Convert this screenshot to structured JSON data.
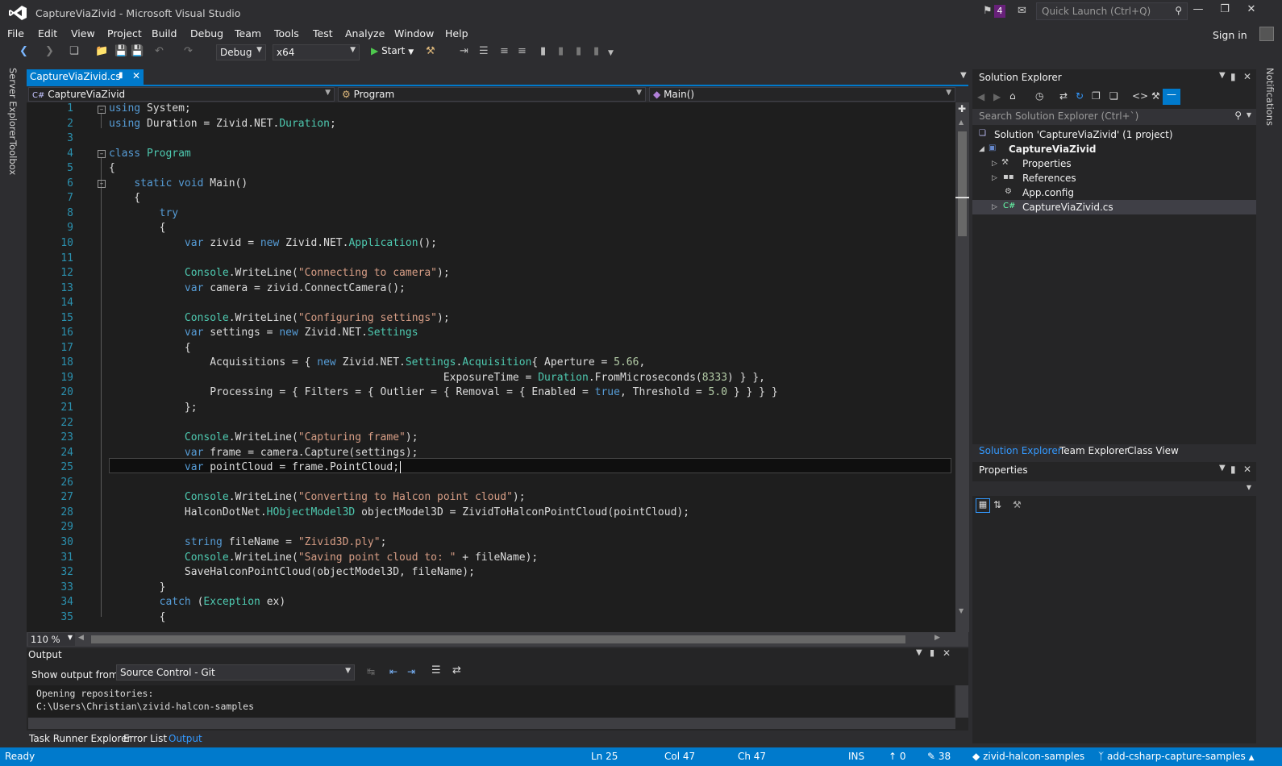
{
  "window": {
    "title": "CaptureViaZivid - Microsoft Visual Studio",
    "notifications_count": "4",
    "quick_launch_placeholder": "Quick Launch (Ctrl+Q)",
    "sign_in": "Sign in"
  },
  "menu": [
    "File",
    "Edit",
    "View",
    "Project",
    "Build",
    "Debug",
    "Team",
    "Tools",
    "Test",
    "Analyze",
    "Window",
    "Help"
  ],
  "toolbar": {
    "configuration": "Debug",
    "platform": "x64",
    "start": "Start"
  },
  "side_tabs": {
    "left": [
      "Server Explorer",
      "Toolbox"
    ],
    "right": [
      "Notifications"
    ]
  },
  "document_tab": {
    "name": "CaptureViaZivid.cs"
  },
  "nav": {
    "project": "CaptureViaZivid",
    "class": "Program",
    "member": "Main()"
  },
  "editor": {
    "line_numbers": [
      "1",
      "2",
      "3",
      "4",
      "5",
      "6",
      "7",
      "8",
      "9",
      "10",
      "11",
      "12",
      "13",
      "14",
      "15",
      "16",
      "17",
      "18",
      "19",
      "20",
      "21",
      "22",
      "23",
      "24",
      "25",
      "26",
      "27",
      "28",
      "29",
      "30",
      "31",
      "32",
      "33",
      "34",
      "35"
    ],
    "lines": [
      [
        {
          "t": "using",
          "c": "kw"
        },
        {
          "t": " System;"
        }
      ],
      [
        {
          "t": "using",
          "c": "kw"
        },
        {
          "t": " Duration = Zivid.NET."
        },
        {
          "t": "Duration",
          "c": "ty"
        },
        {
          "t": ";"
        }
      ],
      [],
      [
        {
          "t": "class",
          "c": "kw"
        },
        {
          "t": " "
        },
        {
          "t": "Program",
          "c": "ty"
        }
      ],
      [
        {
          "t": "{"
        }
      ],
      [
        {
          "t": "    "
        },
        {
          "t": "static",
          "c": "kw"
        },
        {
          "t": " "
        },
        {
          "t": "void",
          "c": "kw"
        },
        {
          "t": " Main()"
        }
      ],
      [
        {
          "t": "    {"
        }
      ],
      [
        {
          "t": "        "
        },
        {
          "t": "try",
          "c": "kw"
        }
      ],
      [
        {
          "t": "        {"
        }
      ],
      [
        {
          "t": "            "
        },
        {
          "t": "var",
          "c": "kw"
        },
        {
          "t": " zivid = "
        },
        {
          "t": "new",
          "c": "kw"
        },
        {
          "t": " Zivid.NET."
        },
        {
          "t": "Application",
          "c": "ty"
        },
        {
          "t": "();"
        }
      ],
      [],
      [
        {
          "t": "            "
        },
        {
          "t": "Console",
          "c": "ty"
        },
        {
          "t": ".WriteLine("
        },
        {
          "t": "\"Connecting to camera\"",
          "c": "st"
        },
        {
          "t": ");"
        }
      ],
      [
        {
          "t": "            "
        },
        {
          "t": "var",
          "c": "kw"
        },
        {
          "t": " camera = zivid.ConnectCamera();"
        }
      ],
      [],
      [
        {
          "t": "            "
        },
        {
          "t": "Console",
          "c": "ty"
        },
        {
          "t": ".WriteLine("
        },
        {
          "t": "\"Configuring settings\"",
          "c": "st"
        },
        {
          "t": ");"
        }
      ],
      [
        {
          "t": "            "
        },
        {
          "t": "var",
          "c": "kw"
        },
        {
          "t": " settings = "
        },
        {
          "t": "new",
          "c": "kw"
        },
        {
          "t": " Zivid.NET."
        },
        {
          "t": "Settings",
          "c": "ty"
        }
      ],
      [
        {
          "t": "            {"
        }
      ],
      [
        {
          "t": "                Acquisitions = { "
        },
        {
          "t": "new",
          "c": "kw"
        },
        {
          "t": " Zivid.NET."
        },
        {
          "t": "Settings",
          "c": "ty"
        },
        {
          "t": "."
        },
        {
          "t": "Acquisition",
          "c": "ty"
        },
        {
          "t": "{ Aperture = "
        },
        {
          "t": "5.66",
          "c": "nm"
        },
        {
          "t": ","
        }
      ],
      [
        {
          "t": "                                                     ExposureTime = "
        },
        {
          "t": "Duration",
          "c": "ty"
        },
        {
          "t": ".FromMicroseconds("
        },
        {
          "t": "8333",
          "c": "nm"
        },
        {
          "t": ") } },"
        }
      ],
      [
        {
          "t": "                Processing = { Filters = { Outlier = { Removal = { Enabled = "
        },
        {
          "t": "true",
          "c": "kw"
        },
        {
          "t": ", Threshold = "
        },
        {
          "t": "5.0",
          "c": "nm"
        },
        {
          "t": " } } } }"
        }
      ],
      [
        {
          "t": "            };"
        }
      ],
      [],
      [
        {
          "t": "            "
        },
        {
          "t": "Console",
          "c": "ty"
        },
        {
          "t": ".WriteLine("
        },
        {
          "t": "\"Capturing frame\"",
          "c": "st"
        },
        {
          "t": ");"
        }
      ],
      [
        {
          "t": "            "
        },
        {
          "t": "var",
          "c": "kw"
        },
        {
          "t": " frame = camera.Capture(settings);"
        }
      ],
      [
        {
          "t": "            "
        },
        {
          "t": "var",
          "c": "kw"
        },
        {
          "t": " pointCloud = frame.PointCloud;"
        }
      ],
      [],
      [
        {
          "t": "            "
        },
        {
          "t": "Console",
          "c": "ty"
        },
        {
          "t": ".WriteLine("
        },
        {
          "t": "\"Converting to Halcon point cloud\"",
          "c": "st"
        },
        {
          "t": ");"
        }
      ],
      [
        {
          "t": "            HalconDotNet."
        },
        {
          "t": "HObjectModel3D",
          "c": "ty"
        },
        {
          "t": " objectModel3D = ZividToHalconPointCloud(pointCloud);"
        }
      ],
      [],
      [
        {
          "t": "            "
        },
        {
          "t": "string",
          "c": "kw"
        },
        {
          "t": " fileName = "
        },
        {
          "t": "\"Zivid3D.ply\"",
          "c": "st"
        },
        {
          "t": ";"
        }
      ],
      [
        {
          "t": "            "
        },
        {
          "t": "Console",
          "c": "ty"
        },
        {
          "t": ".WriteLine("
        },
        {
          "t": "\"Saving point cloud to: \"",
          "c": "st"
        },
        {
          "t": " + fileName);"
        }
      ],
      [
        {
          "t": "            SaveHalconPointCloud(objectModel3D, fileName);"
        }
      ],
      [
        {
          "t": "        }"
        }
      ],
      [
        {
          "t": "        "
        },
        {
          "t": "catch",
          "c": "kw"
        },
        {
          "t": " ("
        },
        {
          "t": "Exception",
          "c": "ty"
        },
        {
          "t": " ex)"
        }
      ],
      [
        {
          "t": "        {"
        }
      ]
    ]
  },
  "zoom": "110 %",
  "output": {
    "title": "Output",
    "show_from_label": "Show output from:",
    "source": "Source Control - Git",
    "text": "Opening repositories:\nC:\\Users\\Christian\\zivid-halcon-samples"
  },
  "bottom_tabs": [
    "Task Runner Explorer",
    "Error List",
    "Output"
  ],
  "solution_explorer": {
    "title": "Solution Explorer",
    "search_placeholder": "Search Solution Explorer (Ctrl+`)",
    "tree": [
      {
        "label": "Solution 'CaptureViaZivid' (1 project)"
      },
      {
        "label": "CaptureViaZivid"
      },
      {
        "label": "Properties"
      },
      {
        "label": "References"
      },
      {
        "label": "App.config"
      },
      {
        "label": "CaptureViaZivid.cs"
      }
    ],
    "tabs": [
      "Solution Explorer",
      "Team Explorer",
      "Class View"
    ]
  },
  "properties": {
    "title": "Properties"
  },
  "status": {
    "ready": "Ready",
    "ln": "Ln 25",
    "col": "Col 47",
    "ch": "Ch 47",
    "ins": "INS",
    "up_count": "0",
    "pending": "38",
    "repo": "zivid-halcon-samples",
    "branch": "add-csharp-capture-samples"
  },
  "colors": {
    "accent": "#007acc",
    "keyword": "#569cd6",
    "type": "#4ec9b0",
    "string": "#d69d85",
    "number": "#b5cea8",
    "line_number": "#2b91af"
  }
}
